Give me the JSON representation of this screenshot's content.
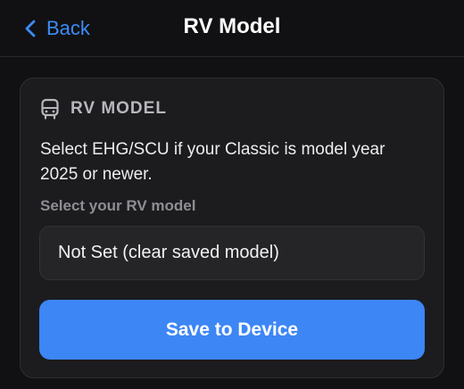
{
  "nav": {
    "back_label": "Back",
    "title": "RV Model"
  },
  "card": {
    "icon": "bus-icon",
    "title": "RV MODEL",
    "description": "Select EHG/SCU if your Classic is model year 2025 or newer.",
    "select_label": "Select your RV model",
    "select_value": "Not Set (clear saved model)",
    "save_label": "Save to Device"
  },
  "colors": {
    "accent": "#3d86f6",
    "background": "#111113",
    "card": "#1c1c1f"
  }
}
